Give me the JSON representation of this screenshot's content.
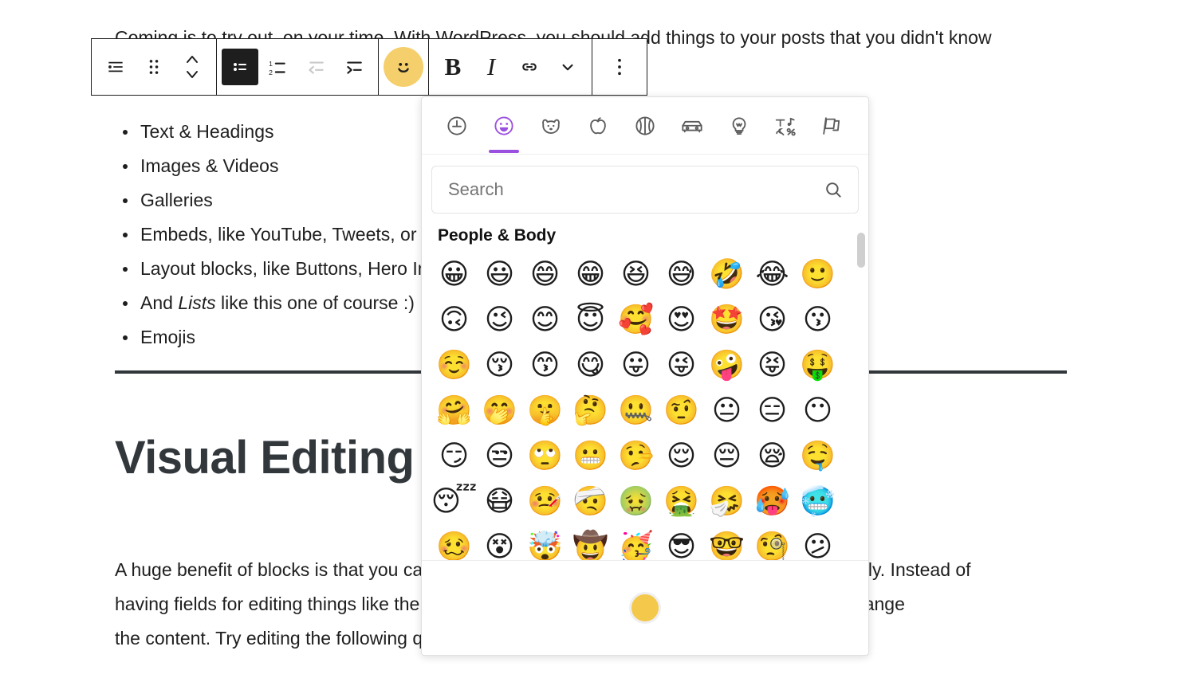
{
  "post": {
    "intro_text": "Coming is to try out, on your time. With WordPress, you should add things to your posts that you didn't know",
    "list_items": [
      {
        "text": "Text & Headings",
        "italic_part": ""
      },
      {
        "text": "Images & Videos",
        "italic_part": ""
      },
      {
        "text": "Galleries",
        "italic_part": ""
      },
      {
        "text": "Embeds, like YouTube, Tweets, or other WordPress posts.",
        "italic_part": ""
      },
      {
        "text": "Layout blocks, like Buttons, Hero Images, Separators, etc.",
        "italic_part": ""
      },
      {
        "text": "And Lists like this one of course :)",
        "italic_part": "Lists"
      },
      {
        "text": "Emojis",
        "italic_part": ""
      }
    ],
    "heading": "Visual Editing",
    "paragraph_lines": [
      "A huge benefit of blocks is that you can edit them in place and manipulate your content directly. Instead of",
      "having fields for editing things like the caption, or the source of an image, you can directly change",
      "the content. Try editing the following quote:"
    ]
  },
  "toolbar": {
    "groups": [
      {
        "name": "block-controls",
        "buttons": [
          {
            "name": "block-type-list-icon",
            "label": "List",
            "icon": "list-block-icon",
            "state": "default"
          },
          {
            "name": "drag-handle-icon",
            "label": "Drag",
            "icon": "drag-dots-icon",
            "state": "default"
          },
          {
            "name": "move-updown-icon",
            "label": "Move up or down",
            "icon": "chevron-updown-icon",
            "state": "default"
          }
        ]
      },
      {
        "name": "list-formatting",
        "buttons": [
          {
            "name": "unordered-list-button",
            "label": "Unordered list",
            "icon": "bullet-list-icon",
            "state": "active"
          },
          {
            "name": "ordered-list-button",
            "label": "Ordered list",
            "icon": "numbered-list-icon",
            "state": "default"
          },
          {
            "name": "outdent-button",
            "label": "Outdent",
            "icon": "outdent-icon",
            "state": "disabled"
          },
          {
            "name": "indent-button",
            "label": "Indent",
            "icon": "indent-icon",
            "state": "default"
          }
        ]
      },
      {
        "name": "emoji-toggle",
        "buttons": [
          {
            "name": "emoji-button",
            "label": "Emoji",
            "icon": "smiley-icon",
            "state": "active-highlight"
          }
        ]
      },
      {
        "name": "text-formatting",
        "buttons": [
          {
            "name": "bold-button",
            "label": "B",
            "icon": "bold-icon",
            "state": "default"
          },
          {
            "name": "italic-button",
            "label": "I",
            "icon": "italic-icon",
            "state": "default"
          },
          {
            "name": "link-button",
            "label": "Link",
            "icon": "link-icon",
            "state": "default"
          },
          {
            "name": "more-formatting-button",
            "label": "More",
            "icon": "chevron-down-icon",
            "state": "default"
          }
        ]
      },
      {
        "name": "block-options",
        "buttons": [
          {
            "name": "block-options-button",
            "label": "Options",
            "icon": "vertical-dots-icon",
            "state": "default"
          }
        ]
      }
    ]
  },
  "emoji_picker": {
    "categories": [
      {
        "name": "frequently-used",
        "icon": "clock-icon",
        "selected": false
      },
      {
        "name": "smileys-people",
        "icon": "smiley-icon",
        "selected": true
      },
      {
        "name": "animals-nature",
        "icon": "dog-icon",
        "selected": false
      },
      {
        "name": "food-drink",
        "icon": "apple-icon",
        "selected": false
      },
      {
        "name": "activities",
        "icon": "basketball-icon",
        "selected": false
      },
      {
        "name": "travel-places",
        "icon": "car-icon",
        "selected": false
      },
      {
        "name": "objects",
        "icon": "lightbulb-icon",
        "selected": false
      },
      {
        "name": "symbols",
        "icon": "symbols-icon",
        "selected": false
      },
      {
        "name": "flags",
        "icon": "flag-icon",
        "selected": false
      }
    ],
    "search": {
      "value": "",
      "placeholder": "Search"
    },
    "section_title": "People & Body",
    "emojis": [
      "😀",
      "😃",
      "😄",
      "😁",
      "😆",
      "😅",
      "🤣",
      "😂",
      "🙂",
      "🙃",
      "😉",
      "😊",
      "😇",
      "🥰",
      "😍",
      "🤩",
      "😘",
      "😗",
      "☺️",
      "😚",
      "😙",
      "😋",
      "😛",
      "😜",
      "🤪",
      "😝",
      "🤑",
      "🤗",
      "🤭",
      "🤫",
      "🤔",
      "🤐",
      "🤨",
      "😐",
      "😑",
      "😶",
      "😏",
      "😒",
      "🙄",
      "😬",
      "🤥",
      "😌",
      "😔",
      "😪",
      "🤤",
      "😴",
      "😷",
      "🤒",
      "🤕",
      "🤢",
      "🤮",
      "🤧",
      "🥵",
      "🥶",
      "🥴",
      "😵",
      "🤯",
      "🤠",
      "🥳",
      "😎",
      "🤓",
      "🧐",
      "😕"
    ],
    "skin_tone": {
      "name": "skin-tone-selector",
      "color": "#f4c84b"
    }
  },
  "colors": {
    "accent_purple": "#9b51e0",
    "emoji_highlight": "#f5cf6b",
    "toolbar_border": "#1e1e1e",
    "text": "#1e1e1e",
    "heading": "#32373c"
  }
}
